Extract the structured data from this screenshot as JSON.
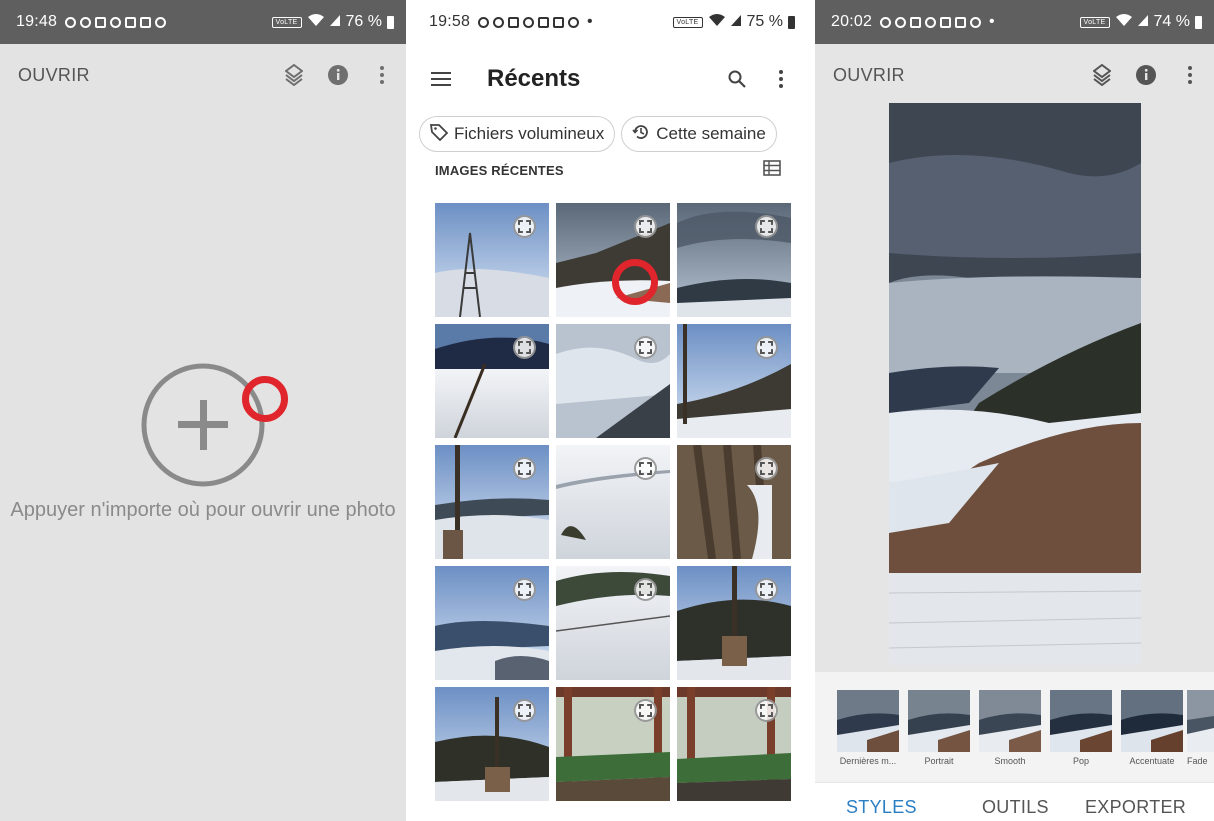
{
  "colors": {
    "accent": "#2a7fc4",
    "red_marker": "#e0262c",
    "status_dark": "#5f5f5f"
  },
  "panels": {
    "snapseed_empty": {
      "status": {
        "time": "19:48",
        "battery": "76 %",
        "network": "VoLTE"
      },
      "appbar": {
        "open_label": "OUVRIR",
        "icons": [
          "layers-icon",
          "info-icon",
          "more-vert-icon"
        ]
      },
      "empty_message": "Appuyer n'importe où pour ouvrir une photo"
    },
    "picker": {
      "status": {
        "time": "19:58",
        "battery": "75 %",
        "network": "VoLTE"
      },
      "title": "Récents",
      "chips": [
        {
          "label": "Fichiers volumineux",
          "icon": "tag-icon"
        },
        {
          "label": "Cette semaine",
          "icon": "history-icon"
        }
      ],
      "section_label": "IMAGES RÉCENTES",
      "thumbnails": [
        "pylon-sky",
        "snowy-hill-selected",
        "cloudy-valley",
        "blue-ridge-snow",
        "grey-sky",
        "pole-hillside",
        "pole-mountains",
        "snow-field",
        "tree-bark",
        "blue-hills",
        "snowy-fence",
        "fence-post",
        "post-hills",
        "veranda-trees",
        "veranda-lawn"
      ]
    },
    "snapseed_editor": {
      "status": {
        "time": "20:02",
        "battery": "74 %",
        "network": "VoLTE"
      },
      "appbar": {
        "open_label": "OUVRIR",
        "icons": [
          "layers-icon",
          "info-icon",
          "more-vert-icon"
        ]
      },
      "filters": [
        "Dernières m...",
        "Portrait",
        "Smooth",
        "Pop",
        "Accentuate",
        "Fade"
      ],
      "tabs": [
        {
          "label": "STYLES",
          "active": true
        },
        {
          "label": "OUTILS",
          "active": false
        },
        {
          "label": "EXPORTER",
          "active": false
        }
      ]
    }
  }
}
